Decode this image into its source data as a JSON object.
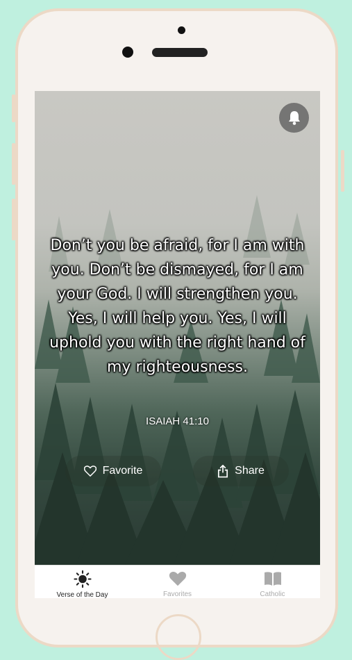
{
  "verse": {
    "text": "Don’t you be afraid, for I am with you. Don’t be dismayed, for I am your God. I will strengthen you. Yes, I will help you. Yes, I will uphold you with the right hand of my righteousness.",
    "reference": "ISAIAH 41:10"
  },
  "actions": {
    "favorite_label": "Favorite",
    "share_label": "Share"
  },
  "tabs": [
    {
      "label": "Verse of the Day",
      "icon": "sun-icon",
      "active": true
    },
    {
      "label": "Favorites",
      "icon": "heart-icon",
      "active": false
    },
    {
      "label": "Catholic",
      "icon": "book-icon",
      "active": false
    }
  ],
  "colors": {
    "background": "#bff0df",
    "phone_frame": "#ecd9c6",
    "tab_active": "#222222",
    "tab_inactive": "#aaaaaa"
  }
}
